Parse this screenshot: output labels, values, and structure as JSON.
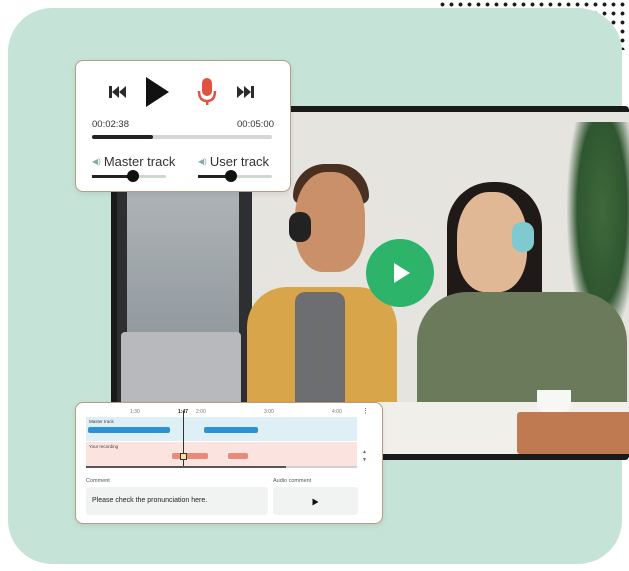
{
  "player": {
    "current_time": "00:02:38",
    "total_time": "00:05:00",
    "progress": 0.34,
    "icons": {
      "previous": "skip-back-icon",
      "play": "play-icon",
      "record": "microphone-icon",
      "next": "skip-forward-icon",
      "volume": "speaker-icon"
    },
    "tracks": [
      {
        "label": "Master track",
        "level": 0.55
      },
      {
        "label": "User track",
        "level": 0.45
      }
    ],
    "colors": {
      "record": "#e0533f",
      "text": "#333333"
    }
  },
  "video": {
    "play_icon": "play-icon",
    "play_color": "#2db36a"
  },
  "editor": {
    "ruler": [
      "1:30",
      "1:47",
      "2:00",
      "3:00",
      "4:00"
    ],
    "lanes": [
      "Master track",
      "Your recording"
    ],
    "comment_label": "Comment",
    "comment_text": "Please check the pronunciation here.",
    "audio_comment_label": "Audio comment",
    "menu_icon": "more-vertical-icon",
    "audio_play_icon": "play-icon"
  },
  "background": {
    "panel_color": "#c5e3d6"
  }
}
